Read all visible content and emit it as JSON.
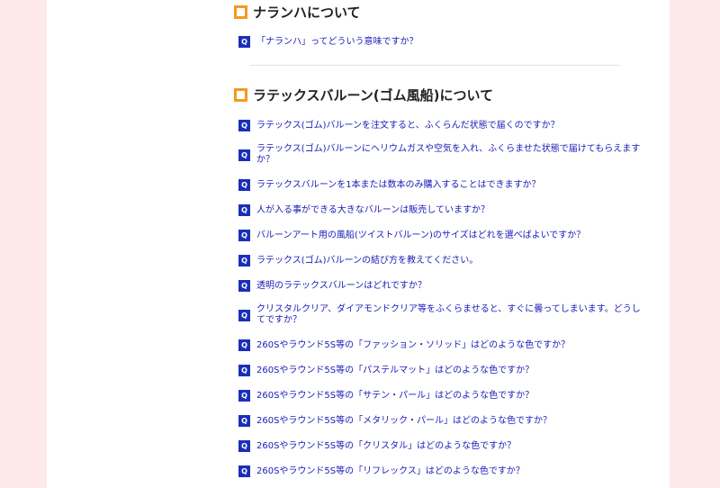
{
  "sections": [
    {
      "title": "ナランハについて",
      "questions": [
        "「ナランハ」ってどういう意味ですか？"
      ]
    },
    {
      "title": "ラテックスバルーン(ゴム風船)について",
      "questions": [
        "ラテックス(ゴム)バルーンを注文すると、ふくらんだ状態で届くのですか？",
        "ラテックス(ゴム)バルーンにヘリウムガスや空気を入れ、ふくらませた状態で届けてもらえますか？",
        "ラテックスバルーンを1本または数本のみ購入することはできますか？",
        "人が入る事ができる大きなバルーンは販売していますか？",
        "バルーンアート用の風船(ツイストバルーン)のサイズはどれを選べばよいですか？",
        "ラテックス(ゴム)バルーンの結び方を教えてください。",
        "透明のラテックスバルーンはどれですか？",
        "クリスタルクリア、ダイアモンドクリア等をふくらませると、すぐに曇ってしまいます。どうしてですか？",
        "260Sやラウンド5S等の「ファッション・ソリッド」はどのような色ですか？",
        "260Sやラウンド5S等の「パステルマット」はどのような色ですか？",
        "260Sやラウンド5S等の「サテン・パール」はどのような色ですか？",
        "260Sやラウンド5S等の「メタリック・パール」はどのような色ですか？",
        "260Sやラウンド5S等の「クリスタル」はどのような色ですか？",
        "260Sやラウンド5S等の「リフレックス」はどのような色ですか？"
      ]
    }
  ],
  "q_badge": "Q",
  "colors": {
    "background": "#fde9ea",
    "accent_square": "#f39a1e",
    "q_badge": "#1a2fb8",
    "link": "#1a1ab8"
  }
}
